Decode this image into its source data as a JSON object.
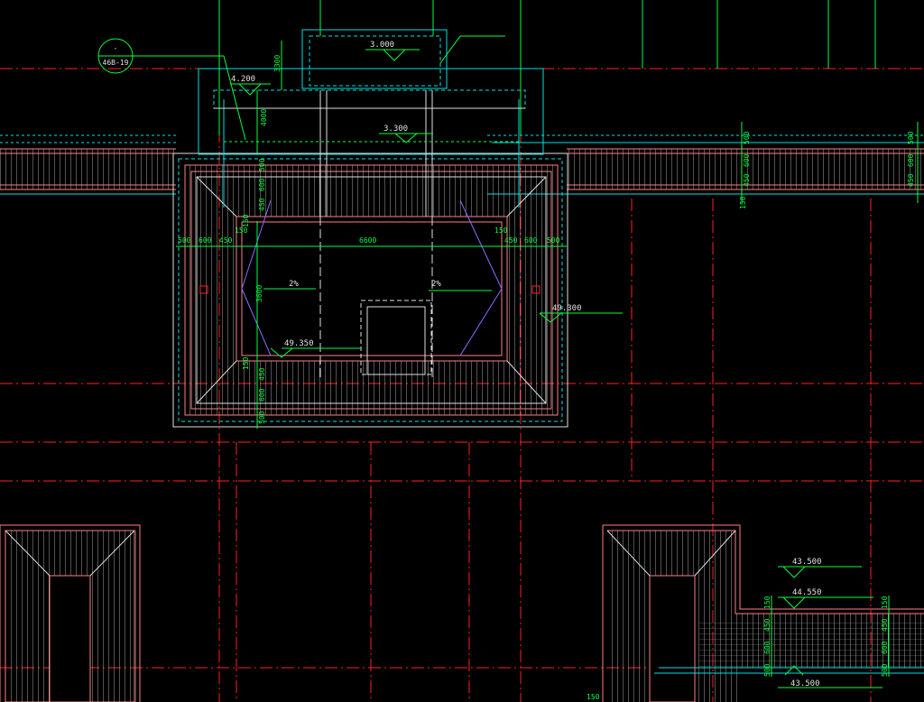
{
  "colors": {
    "background": "#000000",
    "grid_axis": "#ff2020",
    "roof_edge": "#ff8080",
    "cyan": "#00e0e0",
    "green": "#00ff40",
    "white": "#e0e0e0",
    "purple": "#8a6cff",
    "tile": "#cfcfcf"
  },
  "annotations": {
    "elev_3000": "3.000",
    "elev_4200": "4.200",
    "elev_3300": "3.300",
    "slope_left": "2%",
    "slope_right": "2%",
    "elev_49300": "49.300",
    "elev_49350": "49.350",
    "elev_43500": "43.500",
    "elev_44550": "44.550",
    "elev_43500_b": "43.500"
  },
  "dimensions": {
    "d3300": "3300",
    "d4000": "4000",
    "d6600": "6600",
    "d3600": "3600",
    "left_chain": [
      "500",
      "600",
      "450"
    ],
    "right_chain": [
      "450",
      "600",
      "500"
    ],
    "d150a": "150",
    "d150b": "150",
    "right_col_a": [
      "500",
      "600",
      "450"
    ],
    "right_col_b": [
      "500",
      "600",
      "450"
    ],
    "d150_edge": "150",
    "vert_left": [
      "500",
      "600",
      "450",
      "150"
    ],
    "vert_low": [
      "150",
      "450",
      "600",
      "500"
    ],
    "bottom_right_col": [
      "150",
      "450",
      "600",
      "500"
    ],
    "bottom_right_col2": [
      "150",
      "450",
      "600",
      "500"
    ],
    "bottom_150": "150"
  }
}
